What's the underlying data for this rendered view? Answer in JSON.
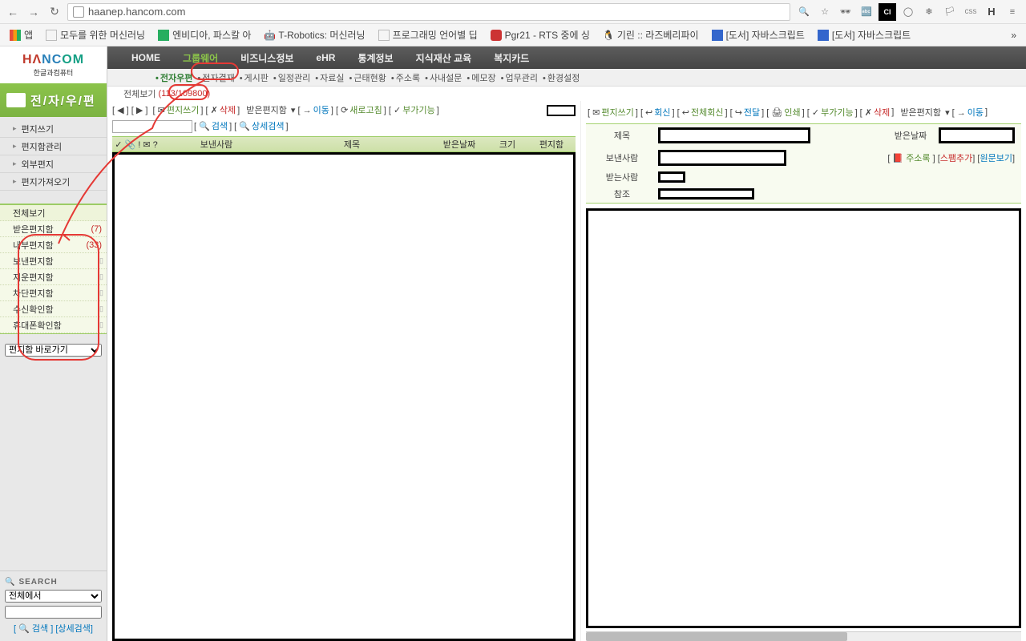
{
  "browser": {
    "url": "haanep.hancom.com",
    "toolIcons": [
      "css",
      "H"
    ]
  },
  "bookmarks": [
    "앱",
    "모두를 위한 머신러닝",
    "엔비디아, 파스칼 아",
    "T-Robotics: 머신러닝",
    "프로그래밍 언어별 딥",
    "Pgr21 - RTS 중에 싱",
    "기린 :: 라즈베리파이",
    "[도서] 자바스크립트",
    "[도서] 자바스크립트"
  ],
  "logo": {
    "text": "HANCOM",
    "sub": "한글과컴퓨터"
  },
  "mailHeader": "전/자/우/편",
  "sideMenu": [
    "편지쓰기",
    "편지함관리",
    "외부편지",
    "편지가져오기"
  ],
  "folders": [
    {
      "label": "전체보기",
      "count": "",
      "del": ""
    },
    {
      "label": "받은편지함",
      "count": "(7)",
      "del": ""
    },
    {
      "label": "내부편지함",
      "count": "(33)",
      "del": ""
    },
    {
      "label": "보낸편지함",
      "count": "",
      "del": "▯"
    },
    {
      "label": "지운편지함",
      "count": "",
      "del": "▯"
    },
    {
      "label": "차단편지함",
      "count": "",
      "del": "▯"
    },
    {
      "label": "수신확인함",
      "count": "",
      "del": "▯"
    },
    {
      "label": "휴대폰확인함",
      "count": "",
      "del": "▯"
    }
  ],
  "quickSelect": "편지함 바로가기",
  "search": {
    "title": "SEARCH",
    "scope": "전체에서",
    "go": "검색",
    "adv": "상세검색"
  },
  "topNav": [
    "HOME",
    "그룹웨어",
    "비즈니스정보",
    "eHR",
    "통계정보",
    "지식재산 교육",
    "복지카드"
  ],
  "subNav": [
    "전자우편",
    "전자결재",
    "게시판",
    "일정관리",
    "자료실",
    "근태현황",
    "주소록",
    "사내설문",
    "메모장",
    "업무관리",
    "환경설정"
  ],
  "statusLabel": "전체보기",
  "statusNums": "(113/109800)",
  "listToolbar": {
    "write": "편지쓰기",
    "delete": "삭제",
    "folder": "받은편지함",
    "move": "이동",
    "refresh": "새로고침",
    "extra": "부가기능",
    "search": "검색",
    "adv": "상세검색"
  },
  "cols": {
    "sender": "보낸사람",
    "subject": "제목",
    "date": "받은날짜",
    "size": "크기",
    "folder": "편지함"
  },
  "detailToolbar": {
    "write": "편지쓰기",
    "reply": "회신",
    "replyAll": "전체회신",
    "forward": "전달",
    "print": "인쇄",
    "extra": "부가기능",
    "delete": "삭제",
    "folder": "받은편지함",
    "move": "이동"
  },
  "detailFields": {
    "subject": "제목",
    "date": "받은날짜",
    "from": "보낸사람",
    "to": "받는사람",
    "cc": "참조",
    "addrbook": "주소록",
    "addspam": "스팸추가",
    "viewsrc": "원문보기"
  }
}
